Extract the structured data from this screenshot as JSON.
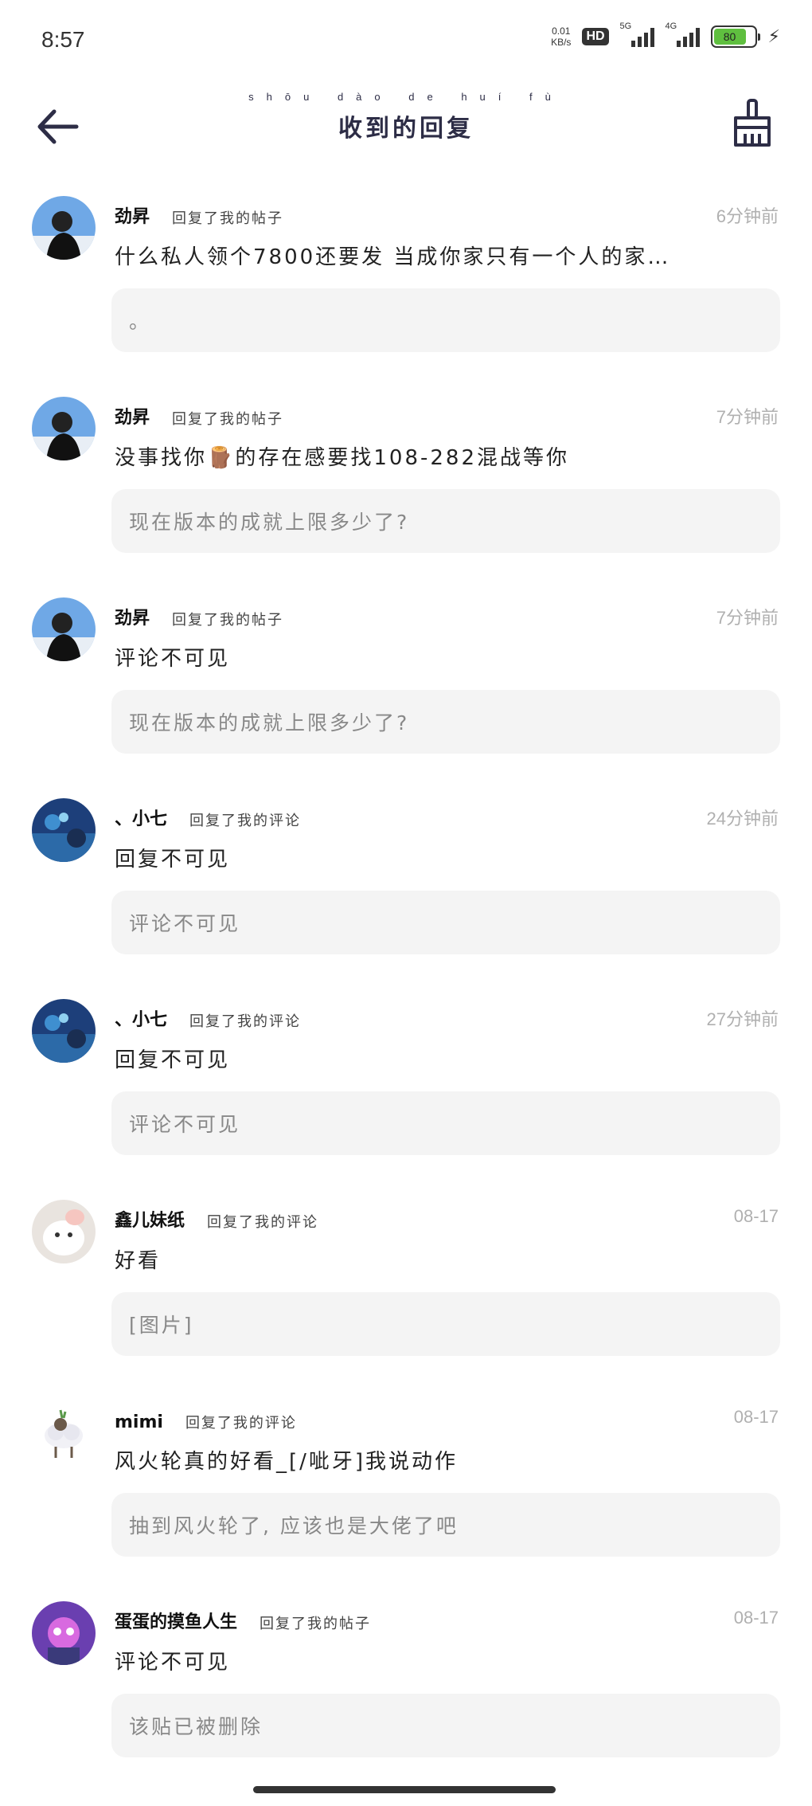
{
  "status_bar": {
    "time": "8:57",
    "net_speed": "0.01",
    "net_speed_unit": "KB/s",
    "hd": "HD",
    "signal1_label": "5G",
    "signal2_label": "4G",
    "battery": "80"
  },
  "header": {
    "title": "收到的回复",
    "title_pinyin": "shōu dào de huí fù"
  },
  "replies": [
    {
      "username": "劲昇",
      "action": "回复了我的帖子",
      "time": "6分钟前",
      "content": "什么私人领个7800还要发 当成你家只有一个人的家…",
      "quote": "。",
      "avatar": "avatar-person-sky"
    },
    {
      "username": "劲昇",
      "action": "回复了我的帖子",
      "time": "7分钟前",
      "content": "没事找你🪵的存在感要找108-282混战等你",
      "quote": "现在版本的成就上限多少了?",
      "avatar": "avatar-person-sky"
    },
    {
      "username": "劲昇",
      "action": "回复了我的帖子",
      "time": "7分钟前",
      "content": "评论不可见",
      "quote": "现在版本的成就上限多少了?",
      "avatar": "avatar-person-sky"
    },
    {
      "username": "、小七",
      "action": "回复了我的评论",
      "time": "24分钟前",
      "content": "回复不可见",
      "quote": "评论不可见",
      "avatar": "avatar-blue-scene"
    },
    {
      "username": "、小七",
      "action": "回复了我的评论",
      "time": "27分钟前",
      "content": "回复不可见",
      "quote": "评论不可见",
      "avatar": "avatar-blue-scene"
    },
    {
      "username": "鑫儿妹纸",
      "action": "回复了我的评论",
      "time": "08-17",
      "content": "好看",
      "quote": "[图片]",
      "avatar": "avatar-white-cat"
    },
    {
      "username": "mimi",
      "action": "回复了我的评论",
      "time": "08-17",
      "content": "风火轮真的好看_[/呲牙]我说动作",
      "quote": "抽到风火轮了, 应该也是大佬了吧",
      "avatar": "avatar-sheep"
    },
    {
      "username": "蛋蛋的摸鱼人生",
      "action": "回复了我的帖子",
      "time": "08-17",
      "content": "评论不可见",
      "quote": "该贴已被删除",
      "avatar": "avatar-purple-character"
    }
  ]
}
